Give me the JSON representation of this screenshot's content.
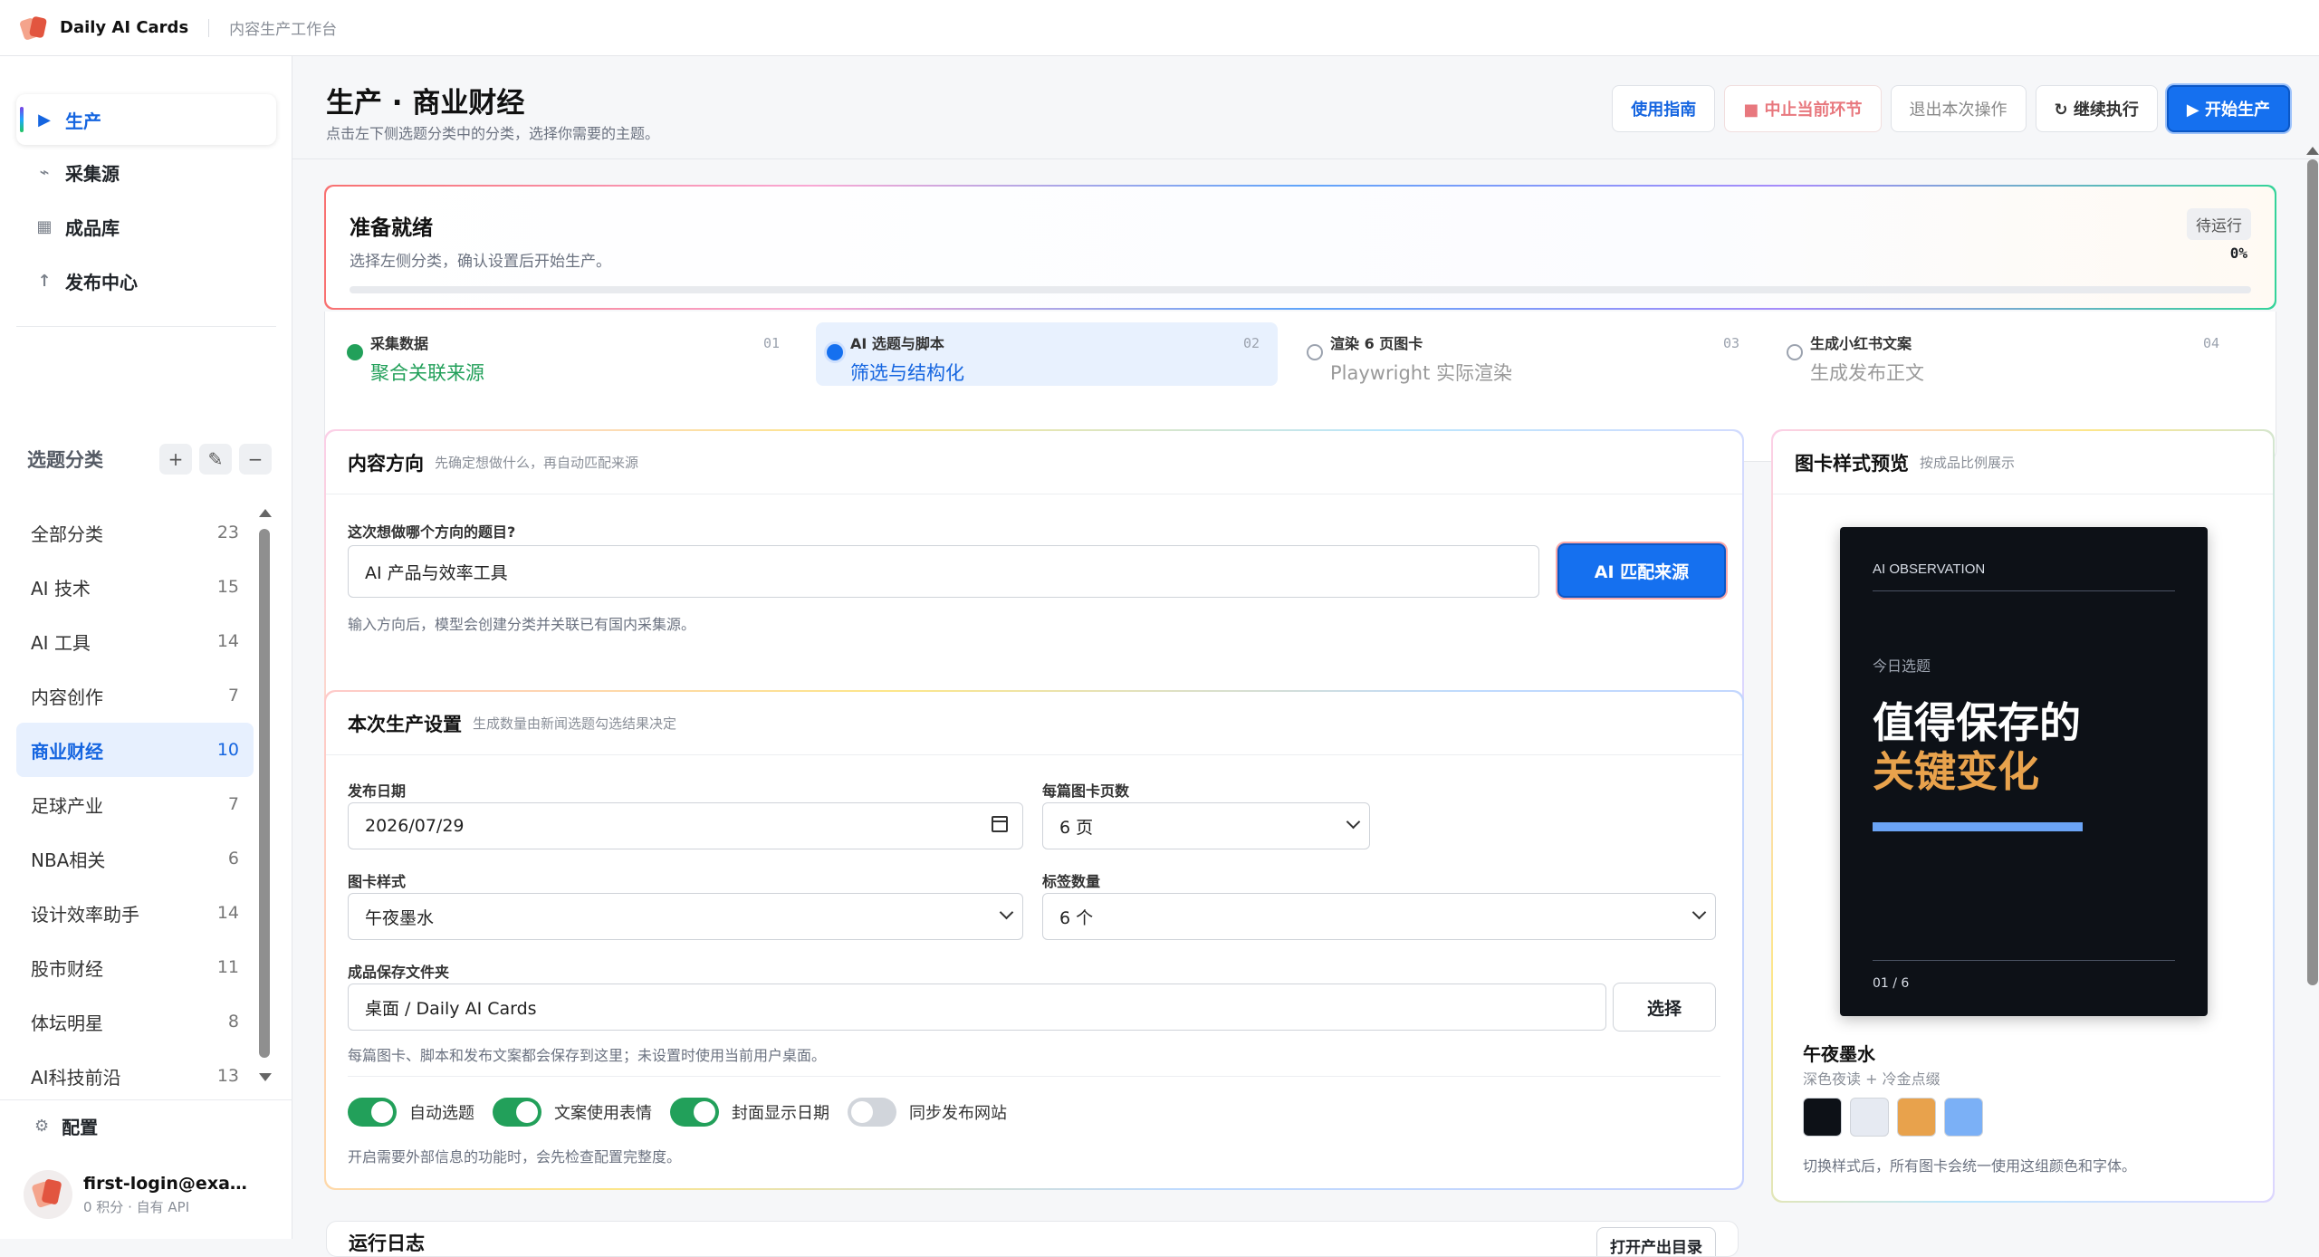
{
  "app": {
    "name": "Daily AI Cards",
    "subtitle": "内容生产工作台"
  },
  "nav": [
    {
      "icon": "play-icon",
      "label": "生产",
      "active": true
    },
    {
      "icon": "source-icon",
      "label": "采集源"
    },
    {
      "icon": "grid-icon",
      "label": "成品库"
    },
    {
      "icon": "upload-icon",
      "label": "发布中心"
    }
  ],
  "categories": {
    "title": "选题分类",
    "items": [
      {
        "label": "全部分类",
        "count": "23"
      },
      {
        "label": "AI 技术",
        "count": "15"
      },
      {
        "label": "AI 工具",
        "count": "14"
      },
      {
        "label": "内容创作",
        "count": "7"
      },
      {
        "label": "商业财经",
        "count": "10",
        "active": true
      },
      {
        "label": "足球产业",
        "count": "7"
      },
      {
        "label": "NBA相关",
        "count": "6"
      },
      {
        "label": "设计效率助手",
        "count": "14"
      },
      {
        "label": "股市财经",
        "count": "11"
      },
      {
        "label": "体坛明星",
        "count": "8"
      },
      {
        "label": "AI科技前沿",
        "count": "13"
      }
    ]
  },
  "config_label": "配置",
  "user": {
    "email": "first-login@example.com",
    "meta": "0 积分 · 自有 API"
  },
  "page": {
    "title": "生产 · 商业财经",
    "subtitle": "点击左下侧选题分类中的分类，选择你需要的主题。"
  },
  "actions": {
    "guide": "使用指南",
    "stop": "■ 中止当前环节",
    "exit": "退出本次操作",
    "continue": "↻ 继续执行",
    "start": "▶ 开始生产"
  },
  "status": {
    "title": "准备就绪",
    "subtitle": "选择左侧分类，确认设置后开始生产。",
    "badge": "待运行",
    "percent": "0%",
    "progress": 0
  },
  "steps": [
    {
      "title": "采集数据",
      "desc": "聚合关联来源",
      "num": "01",
      "state": "done"
    },
    {
      "title": "AI 选题与脚本",
      "desc": "筛选与结构化",
      "num": "02",
      "state": "current"
    },
    {
      "title": "渲染 6 页图卡",
      "desc": "Playwright 实际渲染",
      "num": "03",
      "state": "todo"
    },
    {
      "title": "生成小红书文案",
      "desc": "生成发布正文",
      "num": "04",
      "state": "todo"
    }
  ],
  "direction": {
    "title": "内容方向",
    "hint": "先确定想做什么，再自动匹配来源",
    "question": "这次想做哪个方向的题目?",
    "value": "AI 产品与效率工具",
    "button": "AI 匹配来源",
    "help": "输入方向后，模型会创建分类并关联已有国内采集源。"
  },
  "settings": {
    "title": "本次生产设置",
    "hint": "生成数量由新闻选题勾选结果决定",
    "date_label": "发布日期",
    "date_value": "2026/07/29",
    "pages_label": "每篇图卡页数",
    "pages_value": "6 页",
    "style_label": "图卡样式",
    "style_value": "午夜墨水",
    "tags_label": "标签数量",
    "tags_value": "6 个",
    "folder_label": "成品保存文件夹",
    "folder_value": "桌面 / Daily AI Cards",
    "folder_button": "选择",
    "folder_help": "每篇图卡、脚本和发布文案都会保存到这里；未设置时使用当前用户桌面。",
    "toggles": [
      {
        "label": "自动选题",
        "on": true
      },
      {
        "label": "文案使用表情",
        "on": true
      },
      {
        "label": "封面显示日期",
        "on": true
      },
      {
        "label": "同步发布网站",
        "on": false
      }
    ],
    "toggle_help": "开启需要外部信息的功能时，会先检查配置完整度。"
  },
  "preview": {
    "title": "图卡样式预览",
    "hint": "按成品比例展示",
    "kicker": "AI OBSERVATION",
    "tag": "今日选题",
    "headline1": "值得保存的",
    "headline2": "关键变化",
    "page": "01 / 6",
    "theme_name": "午夜墨水",
    "theme_desc": "深色夜读 + 冷金点缀",
    "swatches": [
      "#0d1117",
      "#e6eaf2",
      "#e8a24c",
      "#7bb0f6"
    ],
    "theme_help": "切换样式后，所有图卡会统一使用这组颜色和字体。"
  },
  "log": {
    "title": "运行日志",
    "button": "打开产出目录"
  }
}
